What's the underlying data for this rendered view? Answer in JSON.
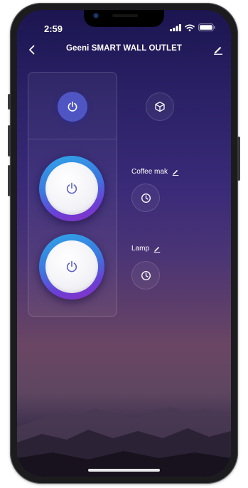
{
  "status_bar": {
    "time": "2:59"
  },
  "nav": {
    "title": "Geeni SMART WALL OUTLET",
    "back_icon": "chevron-left-icon",
    "edit_icon": "pencil-icon"
  },
  "controls": {
    "master_power_icon": "power-icon",
    "scene_icon": "cube-icon"
  },
  "sockets": [
    {
      "label": "Coffee mak",
      "icon": "power-icon",
      "timer_icon": "clock-icon",
      "edit_icon": "pencil-icon"
    },
    {
      "label": "Lamp",
      "icon": "power-icon",
      "timer_icon": "clock-icon",
      "edit_icon": "pencil-icon"
    }
  ],
  "colors": {
    "accent": "#4f56c4",
    "ring_start": "#2fa6e8",
    "ring_end": "#8a2fc4",
    "power_glyph": "#4f56c4"
  }
}
